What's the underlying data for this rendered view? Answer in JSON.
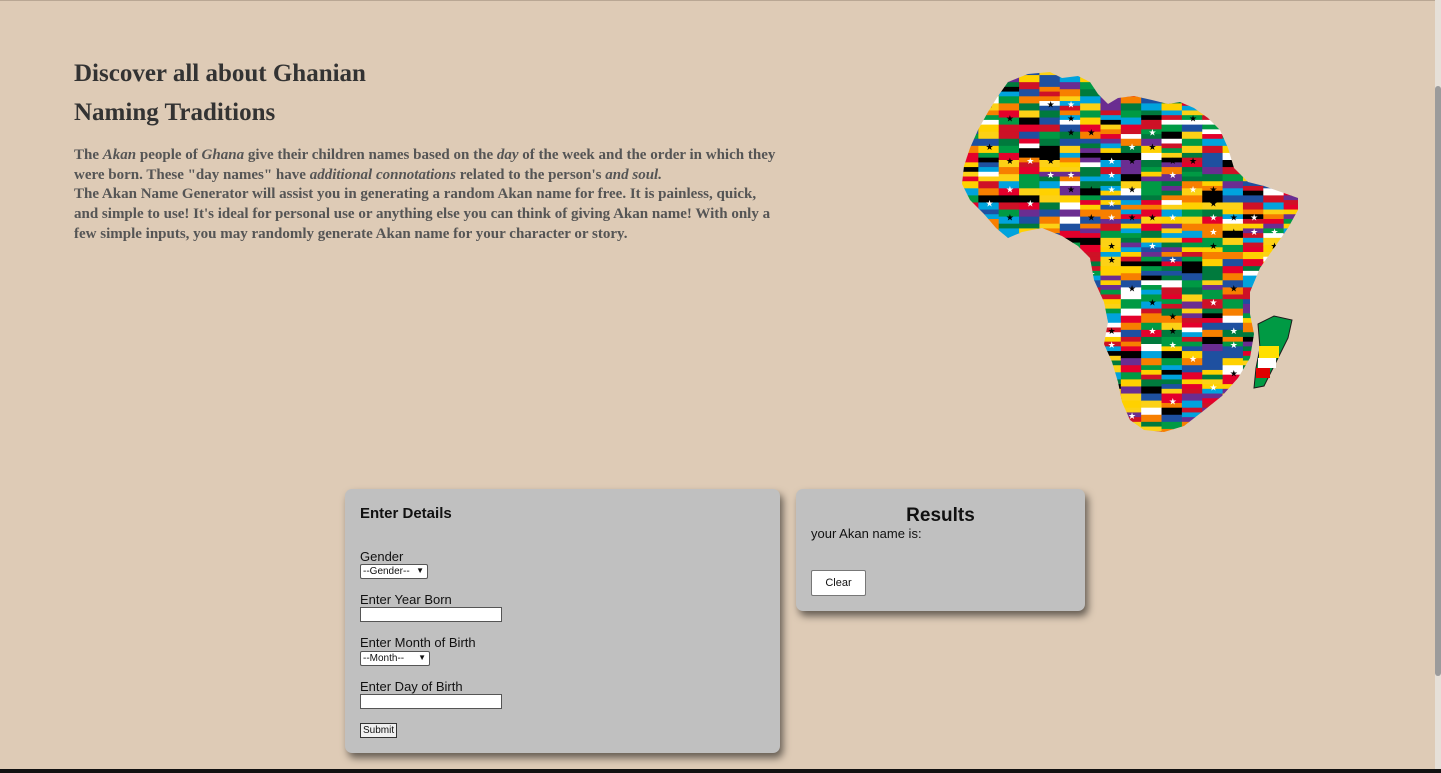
{
  "header": {
    "title_line1": "Discover all about Ghanian",
    "title_line2": "Naming Traditions"
  },
  "intro": {
    "p1": [
      {
        "text": "The ",
        "italic": false
      },
      {
        "text": "Akan",
        "italic": true
      },
      {
        "text": " people of ",
        "italic": false
      },
      {
        "text": "Ghana",
        "italic": true
      },
      {
        "text": " give their children names based on the ",
        "italic": false
      },
      {
        "text": "day",
        "italic": true
      },
      {
        "text": " of the week and the order in which they were born. These \"day names\" have ",
        "italic": false
      },
      {
        "text": "additional connotations",
        "italic": true
      },
      {
        "text": " related to the person's ",
        "italic": false
      },
      {
        "text": "and soul.",
        "italic": true
      }
    ],
    "p2": "The Akan Name Generator will assist you in generating a random Akan name for free. It is painless, quick, and simple to use! It's ideal for personal use or anything else you can think of giving Akan name! With only a few simple inputs, you may randomly generate Akan name for your character or story."
  },
  "map": {
    "icon": "africa-flags-map-icon"
  },
  "form": {
    "title": "Enter Details",
    "gender_label": "Gender",
    "gender_value": "--Gender--",
    "year_label": "Enter Year Born",
    "year_value": "",
    "month_label": "Enter Month of Birth",
    "month_value": "--Month--",
    "day_label": "Enter Day of Birth",
    "day_value": "",
    "submit_label": "Submit"
  },
  "results": {
    "title": "Results",
    "line": "your Akan name is:",
    "clear_label": "Clear"
  },
  "colors": {
    "background": "#decbb6",
    "card": "#c0c0c0",
    "title_text": "#333333",
    "intro_text": "#555555"
  }
}
